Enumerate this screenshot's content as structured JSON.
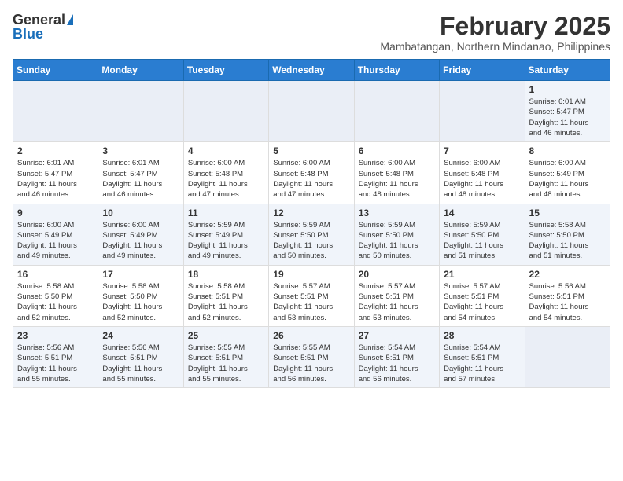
{
  "logo": {
    "general": "General",
    "blue": "Blue"
  },
  "title": {
    "month_year": "February 2025",
    "location": "Mambatangan, Northern Mindanao, Philippines"
  },
  "weekdays": [
    "Sunday",
    "Monday",
    "Tuesday",
    "Wednesday",
    "Thursday",
    "Friday",
    "Saturday"
  ],
  "weeks": [
    [
      {
        "day": "",
        "info": ""
      },
      {
        "day": "",
        "info": ""
      },
      {
        "day": "",
        "info": ""
      },
      {
        "day": "",
        "info": ""
      },
      {
        "day": "",
        "info": ""
      },
      {
        "day": "",
        "info": ""
      },
      {
        "day": "1",
        "info": "Sunrise: 6:01 AM\nSunset: 5:47 PM\nDaylight: 11 hours\nand 46 minutes."
      }
    ],
    [
      {
        "day": "2",
        "info": "Sunrise: 6:01 AM\nSunset: 5:47 PM\nDaylight: 11 hours\nand 46 minutes."
      },
      {
        "day": "3",
        "info": "Sunrise: 6:01 AM\nSunset: 5:47 PM\nDaylight: 11 hours\nand 46 minutes."
      },
      {
        "day": "4",
        "info": "Sunrise: 6:00 AM\nSunset: 5:48 PM\nDaylight: 11 hours\nand 47 minutes."
      },
      {
        "day": "5",
        "info": "Sunrise: 6:00 AM\nSunset: 5:48 PM\nDaylight: 11 hours\nand 47 minutes."
      },
      {
        "day": "6",
        "info": "Sunrise: 6:00 AM\nSunset: 5:48 PM\nDaylight: 11 hours\nand 48 minutes."
      },
      {
        "day": "7",
        "info": "Sunrise: 6:00 AM\nSunset: 5:48 PM\nDaylight: 11 hours\nand 48 minutes."
      },
      {
        "day": "8",
        "info": "Sunrise: 6:00 AM\nSunset: 5:49 PM\nDaylight: 11 hours\nand 48 minutes."
      }
    ],
    [
      {
        "day": "9",
        "info": "Sunrise: 6:00 AM\nSunset: 5:49 PM\nDaylight: 11 hours\nand 49 minutes."
      },
      {
        "day": "10",
        "info": "Sunrise: 6:00 AM\nSunset: 5:49 PM\nDaylight: 11 hours\nand 49 minutes."
      },
      {
        "day": "11",
        "info": "Sunrise: 5:59 AM\nSunset: 5:49 PM\nDaylight: 11 hours\nand 49 minutes."
      },
      {
        "day": "12",
        "info": "Sunrise: 5:59 AM\nSunset: 5:50 PM\nDaylight: 11 hours\nand 50 minutes."
      },
      {
        "day": "13",
        "info": "Sunrise: 5:59 AM\nSunset: 5:50 PM\nDaylight: 11 hours\nand 50 minutes."
      },
      {
        "day": "14",
        "info": "Sunrise: 5:59 AM\nSunset: 5:50 PM\nDaylight: 11 hours\nand 51 minutes."
      },
      {
        "day": "15",
        "info": "Sunrise: 5:58 AM\nSunset: 5:50 PM\nDaylight: 11 hours\nand 51 minutes."
      }
    ],
    [
      {
        "day": "16",
        "info": "Sunrise: 5:58 AM\nSunset: 5:50 PM\nDaylight: 11 hours\nand 52 minutes."
      },
      {
        "day": "17",
        "info": "Sunrise: 5:58 AM\nSunset: 5:50 PM\nDaylight: 11 hours\nand 52 minutes."
      },
      {
        "day": "18",
        "info": "Sunrise: 5:58 AM\nSunset: 5:51 PM\nDaylight: 11 hours\nand 52 minutes."
      },
      {
        "day": "19",
        "info": "Sunrise: 5:57 AM\nSunset: 5:51 PM\nDaylight: 11 hours\nand 53 minutes."
      },
      {
        "day": "20",
        "info": "Sunrise: 5:57 AM\nSunset: 5:51 PM\nDaylight: 11 hours\nand 53 minutes."
      },
      {
        "day": "21",
        "info": "Sunrise: 5:57 AM\nSunset: 5:51 PM\nDaylight: 11 hours\nand 54 minutes."
      },
      {
        "day": "22",
        "info": "Sunrise: 5:56 AM\nSunset: 5:51 PM\nDaylight: 11 hours\nand 54 minutes."
      }
    ],
    [
      {
        "day": "23",
        "info": "Sunrise: 5:56 AM\nSunset: 5:51 PM\nDaylight: 11 hours\nand 55 minutes."
      },
      {
        "day": "24",
        "info": "Sunrise: 5:56 AM\nSunset: 5:51 PM\nDaylight: 11 hours\nand 55 minutes."
      },
      {
        "day": "25",
        "info": "Sunrise: 5:55 AM\nSunset: 5:51 PM\nDaylight: 11 hours\nand 55 minutes."
      },
      {
        "day": "26",
        "info": "Sunrise: 5:55 AM\nSunset: 5:51 PM\nDaylight: 11 hours\nand 56 minutes."
      },
      {
        "day": "27",
        "info": "Sunrise: 5:54 AM\nSunset: 5:51 PM\nDaylight: 11 hours\nand 56 minutes."
      },
      {
        "day": "28",
        "info": "Sunrise: 5:54 AM\nSunset: 5:51 PM\nDaylight: 11 hours\nand 57 minutes."
      },
      {
        "day": "",
        "info": ""
      }
    ]
  ]
}
